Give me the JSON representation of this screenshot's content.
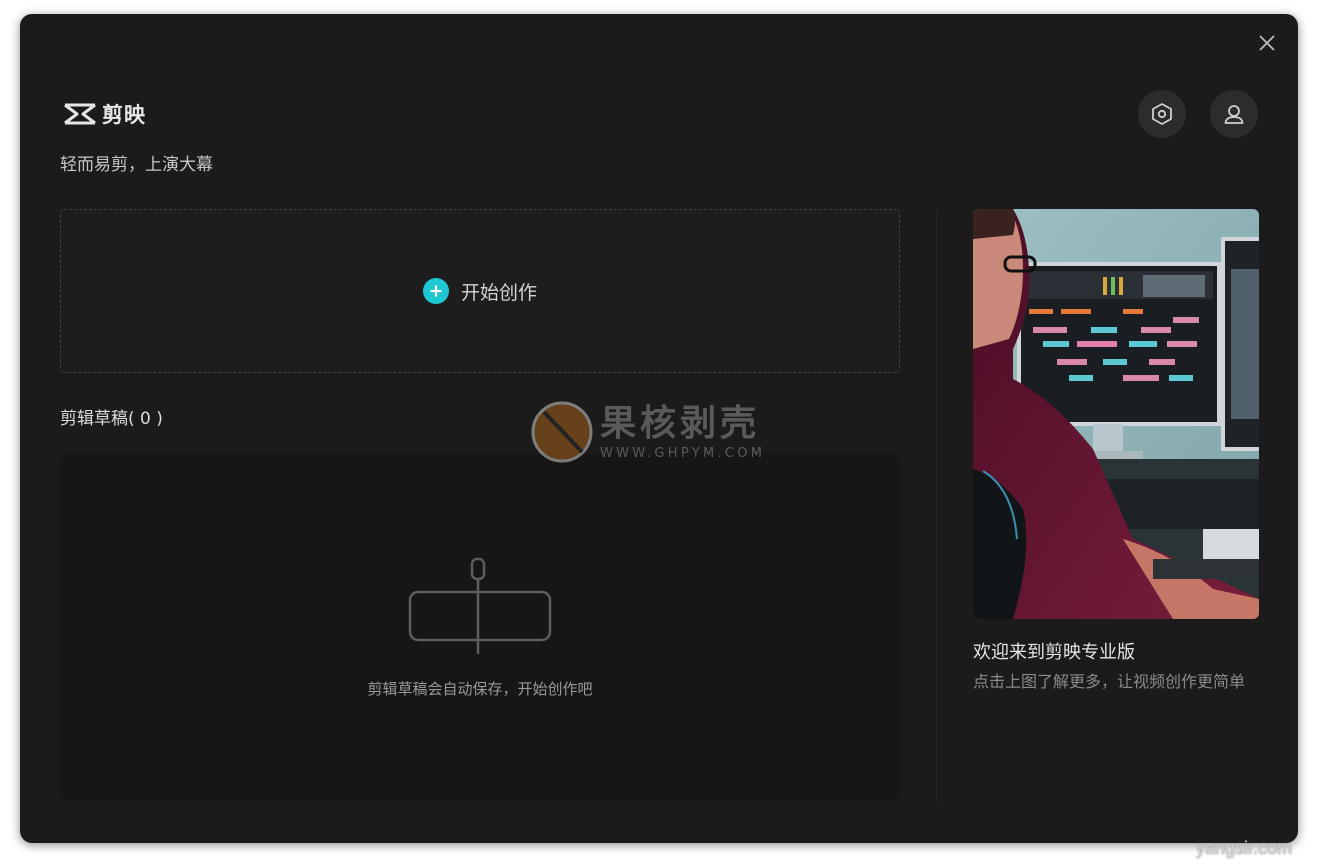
{
  "window": {
    "close_icon": "close-icon"
  },
  "header": {
    "app_name": "剪映",
    "slogan": "轻而易剪，上演大幕",
    "settings_icon": "hexagon-settings-icon",
    "account_icon": "user-icon"
  },
  "create": {
    "label": "开始创作",
    "icon": "plus-circle-icon",
    "accent_color": "#1ec8d2"
  },
  "drafts": {
    "title": "剪辑草稿( 0 )",
    "empty_message": "剪辑草稿会自动保存，开始创作吧"
  },
  "promo": {
    "title": "欢迎来到剪映专业版",
    "description": "点击上图了解更多，让视频创作更简单"
  },
  "watermark": {
    "cn": "果核剥壳",
    "en": "WWW.GHPYM.COM"
  },
  "credit": {
    "text": "yangsir.com"
  }
}
